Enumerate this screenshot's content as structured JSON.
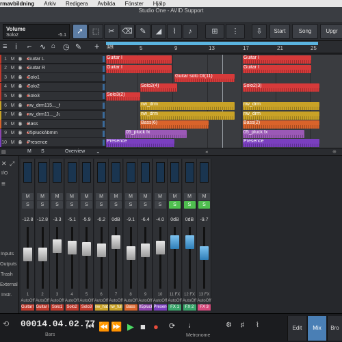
{
  "menubar": {
    "app": "rmavbildning",
    "items": [
      "Arkiv",
      "Redigera",
      "Avbilda",
      "Fönster",
      "Hjälp"
    ]
  },
  "window": {
    "title": "Studio One - AVID Support"
  },
  "toolbar": {
    "param_name": "Volume",
    "param_track": "Solo2",
    "param_value": "-5.1",
    "start": "Start",
    "song": "Song",
    "upgrade": "Upgr"
  },
  "ruler": {
    "marks": [
      "5",
      "9",
      "13",
      "17",
      "21",
      "25"
    ],
    "left_marker": "1/4"
  },
  "tracks": [
    {
      "num": "1",
      "name": "Guitar L"
    },
    {
      "num": "2",
      "name": "Guitar R"
    },
    {
      "num": "3",
      "name": "Solo1"
    },
    {
      "num": "4",
      "name": "Solo2"
    },
    {
      "num": "5",
      "name": "Solo3"
    },
    {
      "num": "6",
      "name": "nw_drm115..._hat"
    },
    {
      "num": "7",
      "name": "nw_drm11..._Jul"
    },
    {
      "num": "8",
      "name": "Bass"
    },
    {
      "num": "9",
      "name": "05pluckAbmin"
    },
    {
      "num": "10",
      "name": "Presence"
    }
  ],
  "clips": {
    "guitar": "Guitar I",
    "solo_di": "Guitar solo DI(11)",
    "solo2": "Solo2(4)",
    "solo2b": "Solo2(3)",
    "solo3": "Solo3(2)",
    "drm": "nw_drm",
    "bass6": "Bass(6)",
    "bass2": "Bass(2)",
    "bass_r": "Bass(2)",
    "pluck": "05_pluck fx",
    "presence": "Presence"
  },
  "ms_labels": {
    "m": "M",
    "s": "S"
  },
  "overview": {
    "label": "Overview",
    "m": "M",
    "s": "S"
  },
  "mixer": {
    "side": [
      "I/O",
      "Inputs",
      "Outputs",
      "Trash",
      "External",
      "Instr."
    ],
    "strips": [
      {
        "vol": "-12.8",
        "auto": "AutoOff",
        "name": "Guitar L",
        "color": "#c0392b",
        "num": "1",
        "solo": false,
        "blue": false,
        "pos": 30
      },
      {
        "vol": "-12.8",
        "auto": "AutoOff",
        "name": "Guitar R",
        "color": "#c0392b",
        "num": "2",
        "solo": false,
        "blue": false,
        "pos": 30
      },
      {
        "vol": "-3.3",
        "auto": "AutoOff",
        "name": "Solo1",
        "color": "#c0392b",
        "num": "3",
        "solo": false,
        "blue": false,
        "pos": 18
      },
      {
        "vol": "-5.1",
        "auto": "AutoOff",
        "name": "Solo2",
        "color": "#c0392b",
        "num": "4",
        "solo": false,
        "blue": false,
        "pos": 20
      },
      {
        "vol": "-5.9",
        "auto": "AutoOff",
        "name": "Solo3",
        "color": "#c0392b",
        "num": "5",
        "solo": false,
        "blue": false,
        "pos": 22
      },
      {
        "vol": "-6.2",
        "auto": "AutoOff",
        "name": "nw_hat",
        "color": "#c9a227",
        "num": "6",
        "solo": false,
        "blue": false,
        "pos": 24
      },
      {
        "vol": "0dB",
        "auto": "AutoOff",
        "name": "nw_full",
        "color": "#c9a227",
        "num": "7",
        "solo": false,
        "blue": false,
        "pos": 12
      },
      {
        "vol": "-9.1",
        "auto": "AutoOff",
        "name": "Bass",
        "color": "#d9632b",
        "num": "8",
        "solo": false,
        "blue": false,
        "pos": 28
      },
      {
        "vol": "-6.4",
        "auto": "AutoOff",
        "name": "05pluck",
        "color": "#8e44ad",
        "num": "9",
        "solo": false,
        "blue": false,
        "pos": 24
      },
      {
        "vol": "-4.0",
        "auto": "AutoOff",
        "name": "Presence",
        "color": "#7a3fbf",
        "num": "10",
        "solo": false,
        "blue": false,
        "pos": 20
      },
      {
        "vol": "0dB",
        "auto": "AutoOff",
        "name": "FX 1",
        "color": "#3aa56b",
        "num": "11 FX",
        "solo": true,
        "blue": true,
        "pos": 12
      },
      {
        "vol": "0dB",
        "auto": "AutoOff",
        "name": "FX 2",
        "color": "#3aa56b",
        "num": "12 FX",
        "solo": true,
        "blue": true,
        "pos": 12
      },
      {
        "vol": "-9.7",
        "auto": "AutoOff",
        "name": "FX 3",
        "color": "#d6497b",
        "num": "13 FX",
        "solo": true,
        "blue": true,
        "pos": 28
      }
    ]
  },
  "transport": {
    "time": "00014.04.02.77",
    "unit": "Bars",
    "metronome": "Metronome",
    "edit": "Edit",
    "mix": "Mix",
    "browse": "Bro"
  }
}
